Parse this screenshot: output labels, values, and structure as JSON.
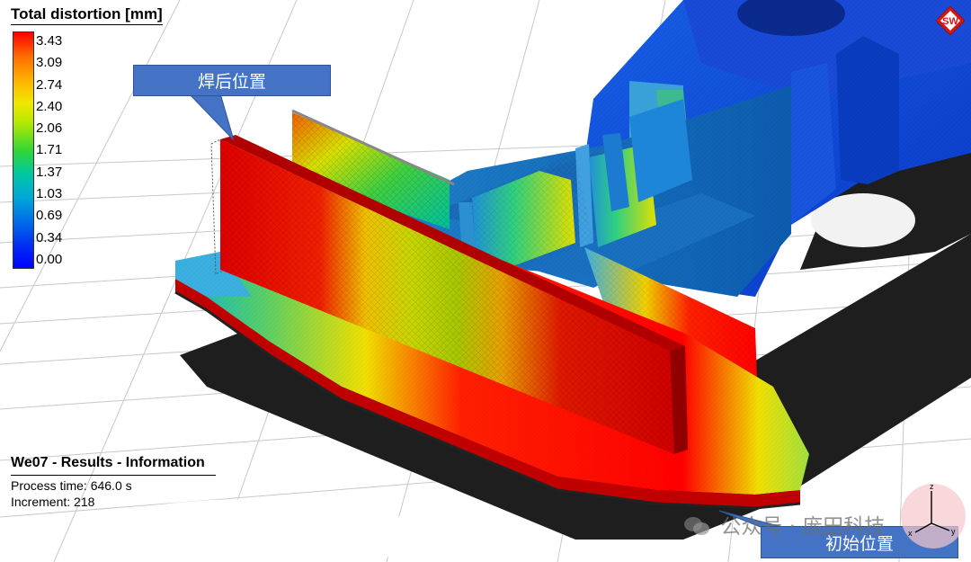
{
  "legend": {
    "title": "Total distortion [mm]",
    "values": [
      "3.43",
      "3.09",
      "2.74",
      "2.40",
      "2.06",
      "1.71",
      "1.37",
      "1.03",
      "0.69",
      "0.34",
      "0.00"
    ]
  },
  "callouts": {
    "weld_position": "焊后位置",
    "initial_position": "初始位置"
  },
  "info": {
    "title": "We07 - Results - Information",
    "process_time": "Process time: 646.0 s",
    "increment": "Increment: 218"
  },
  "logo": {
    "text": "SW"
  },
  "triad": {
    "x": "x",
    "y": "y",
    "z": "z"
  },
  "watermark": {
    "text": "公众号 · 庞田科技"
  },
  "colors": {
    "callout_fill": "#4472c4",
    "max_distortion": "#ff0000",
    "min_distortion": "#0000ff"
  }
}
